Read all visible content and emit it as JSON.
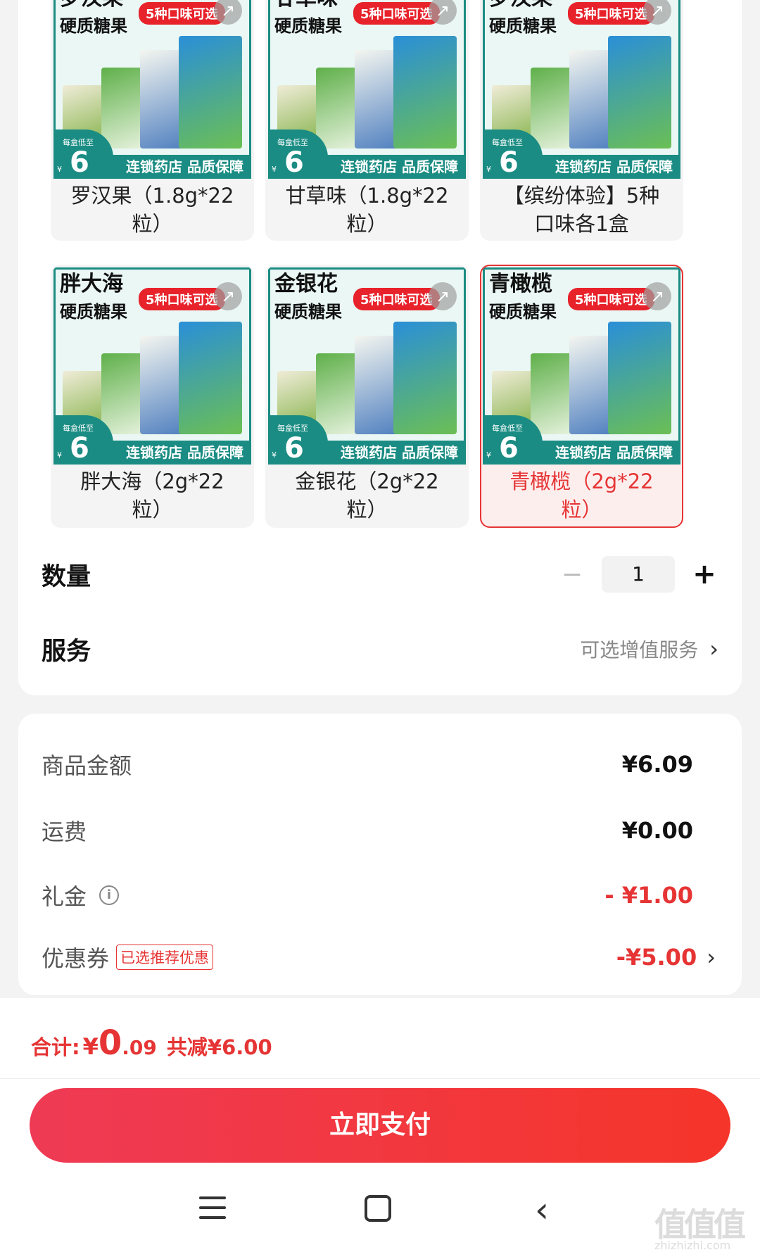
{
  "colors": {
    "accent": "#e63434",
    "teal": "#1a8c83",
    "pay_start": "#ef3a55",
    "pay_end": "#f5352a"
  },
  "skus": [
    {
      "title": "罗汉果",
      "subtitle": "硬质糖果",
      "pill": "5种口味可选",
      "footer": "连锁药店 品质保障",
      "badge_top": "每盒低至",
      "badge_num": "6",
      "badge_cur": "¥",
      "label": "罗汉果（1.8g*22粒）",
      "selected": false
    },
    {
      "title": "甘草味",
      "subtitle": "硬质糖果",
      "pill": "5种口味可选",
      "footer": "连锁药店 品质保障",
      "badge_top": "每盒低至",
      "badge_num": "6",
      "badge_cur": "¥",
      "label": "甘草味（1.8g*22粒）",
      "selected": false
    },
    {
      "title": "罗汉果",
      "subtitle": "硬质糖果",
      "pill": "5种口味可选",
      "footer": "连锁药店 品质保障",
      "badge_top": "每盒低至",
      "badge_num": "6",
      "badge_cur": "¥",
      "label": "【缤纷体验】5种口味各1盒",
      "selected": false
    },
    {
      "title": "胖大海",
      "subtitle": "硬质糖果",
      "pill": "5种口味可选",
      "footer": "连锁药店 品质保障",
      "badge_top": "每盒低至",
      "badge_num": "6",
      "badge_cur": "¥",
      "label": "胖大海（2g*22粒）",
      "selected": false
    },
    {
      "title": "金银花",
      "subtitle": "硬质糖果",
      "pill": "5种口味可选",
      "footer": "连锁药店 品质保障",
      "badge_top": "每盒低至",
      "badge_num": "6",
      "badge_cur": "¥",
      "label": "金银花（2g*22粒）",
      "selected": false
    },
    {
      "title": "青橄榄",
      "subtitle": "硬质糖果",
      "pill": "5种口味可选",
      "footer": "连锁药店 品质保障",
      "badge_top": "每盒低至",
      "badge_num": "6",
      "badge_cur": "¥",
      "label": "青橄榄（2g*22粒）",
      "selected": true
    }
  ],
  "quantity": {
    "label": "数量",
    "minus": "−",
    "value": "1",
    "plus": "+"
  },
  "service": {
    "label": "服务",
    "value": "可选增值服务",
    "chevron": "›"
  },
  "price": {
    "goods_label": "商品金额",
    "goods_value": "¥6.09",
    "shipping_label": "运费",
    "shipping_value": "¥0.00",
    "gift_label": "礼金",
    "gift_info": "i",
    "gift_value": "- ¥1.00",
    "coupon_label": "优惠券",
    "coupon_tag": "已选推荐优惠",
    "coupon_value": "-¥5.00",
    "coupon_chevron": "›"
  },
  "total": {
    "label": "合计:",
    "currency": "¥",
    "integer": "0",
    "decimal": ".09",
    "saved": "共减¥6.00"
  },
  "pay_button": "立即支付",
  "nav": {
    "menu_icon": "menu-icon",
    "home_icon": "home-icon",
    "back_icon": "back-icon",
    "back_glyph": "‹"
  },
  "watermark": {
    "main": "值值值",
    "sub": "zhizhizhi.com"
  }
}
